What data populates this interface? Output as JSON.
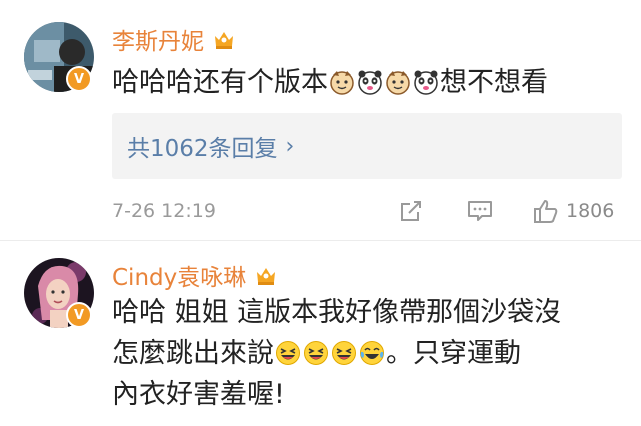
{
  "comments": [
    {
      "username": "李斯丹妮",
      "badge": "V",
      "text_parts": [
        "哈哈哈还有个版本",
        "想不想看"
      ],
      "emojis": [
        "cat-emoji",
        "panda-emoji",
        "cat-emoji",
        "panda-emoji"
      ],
      "replies_label": "共1062条回复",
      "timestamp": "7-26 12:19",
      "like_count": "1806"
    },
    {
      "username": "Cindy袁咏琳",
      "badge": "V",
      "text_lines": [
        "哈哈 姐姐 這版本我好像帶那個沙袋沒",
        "怎麼跳出來說",
        "。只穿運動",
        "內衣好害羞喔!"
      ],
      "emojis": [
        "laugh-squint-emoji",
        "laugh-squint-emoji",
        "laugh-squint-emoji",
        "laugh-tears-emoji"
      ]
    }
  ],
  "colors": {
    "username": "#e8833a",
    "link": "#5a7ea8",
    "meta": "#9a9a9a",
    "badge": "#f29a24"
  }
}
